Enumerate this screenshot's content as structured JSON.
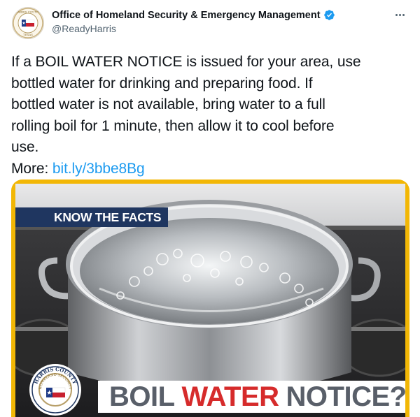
{
  "tweet": {
    "author": {
      "display_name": "Office of Homeland Security & Emergency Management",
      "handle": "@ReadyHarris",
      "verified": true,
      "avatar_icon": "harris-county-seal-icon"
    },
    "more_icon": "more-options-icon",
    "text_lines": [
      "If a BOIL WATER NOTICE is issued for your area, use",
      "bottled water for drinking and preparing food. If",
      "bottled water is not available, bring water to a full",
      "rolling boil for 1 minute, then allow it to cool before",
      "use."
    ],
    "link_prefix": "More: ",
    "link_text": "bit.ly/3bbe8Bg",
    "link_color": "#1d9bf0"
  },
  "media": {
    "frame_color": "#f2b705",
    "know_the_facts": "KNOW THE FACTS",
    "banner": {
      "word1": "BOIL",
      "word2": "WATER",
      "word3": "NOTICE?"
    },
    "seal_text_top": "HARRIS COUNTY",
    "seal_text_inner": "HOMELAND SECURITY"
  }
}
